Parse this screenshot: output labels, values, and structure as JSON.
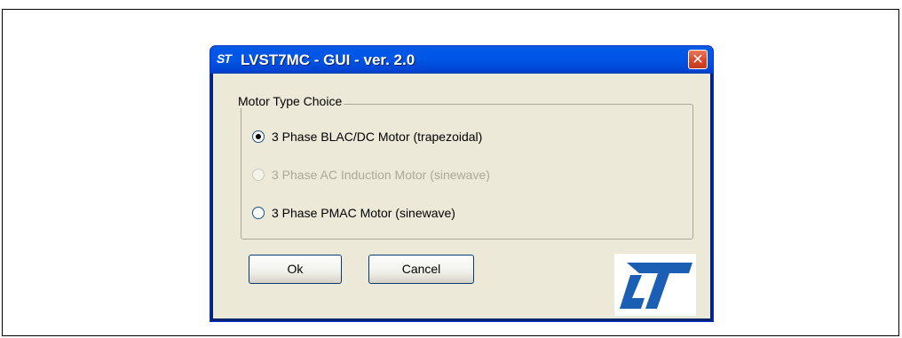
{
  "window": {
    "title": "LVST7MC - GUI - ver. 2.0",
    "title_icon_text": "ST",
    "close_glyph": "✕"
  },
  "group": {
    "label": "Motor Type Choice",
    "options": [
      {
        "label": "3 Phase BLAC/DC Motor (trapezoidal)",
        "selected": true,
        "enabled": true
      },
      {
        "label": "3 Phase AC Induction Motor (sinewave)",
        "selected": false,
        "enabled": false
      },
      {
        "label": "3 Phase PMAC Motor (sinewave)",
        "selected": false,
        "enabled": true
      }
    ]
  },
  "buttons": {
    "ok_label": "Ok",
    "cancel_label": "Cancel"
  },
  "logo": {
    "text": "ST",
    "color": "#1a5fb4"
  },
  "colors": {
    "titlebar": "#0055e5",
    "client": "#ece9d8",
    "close": "#d9482a"
  }
}
